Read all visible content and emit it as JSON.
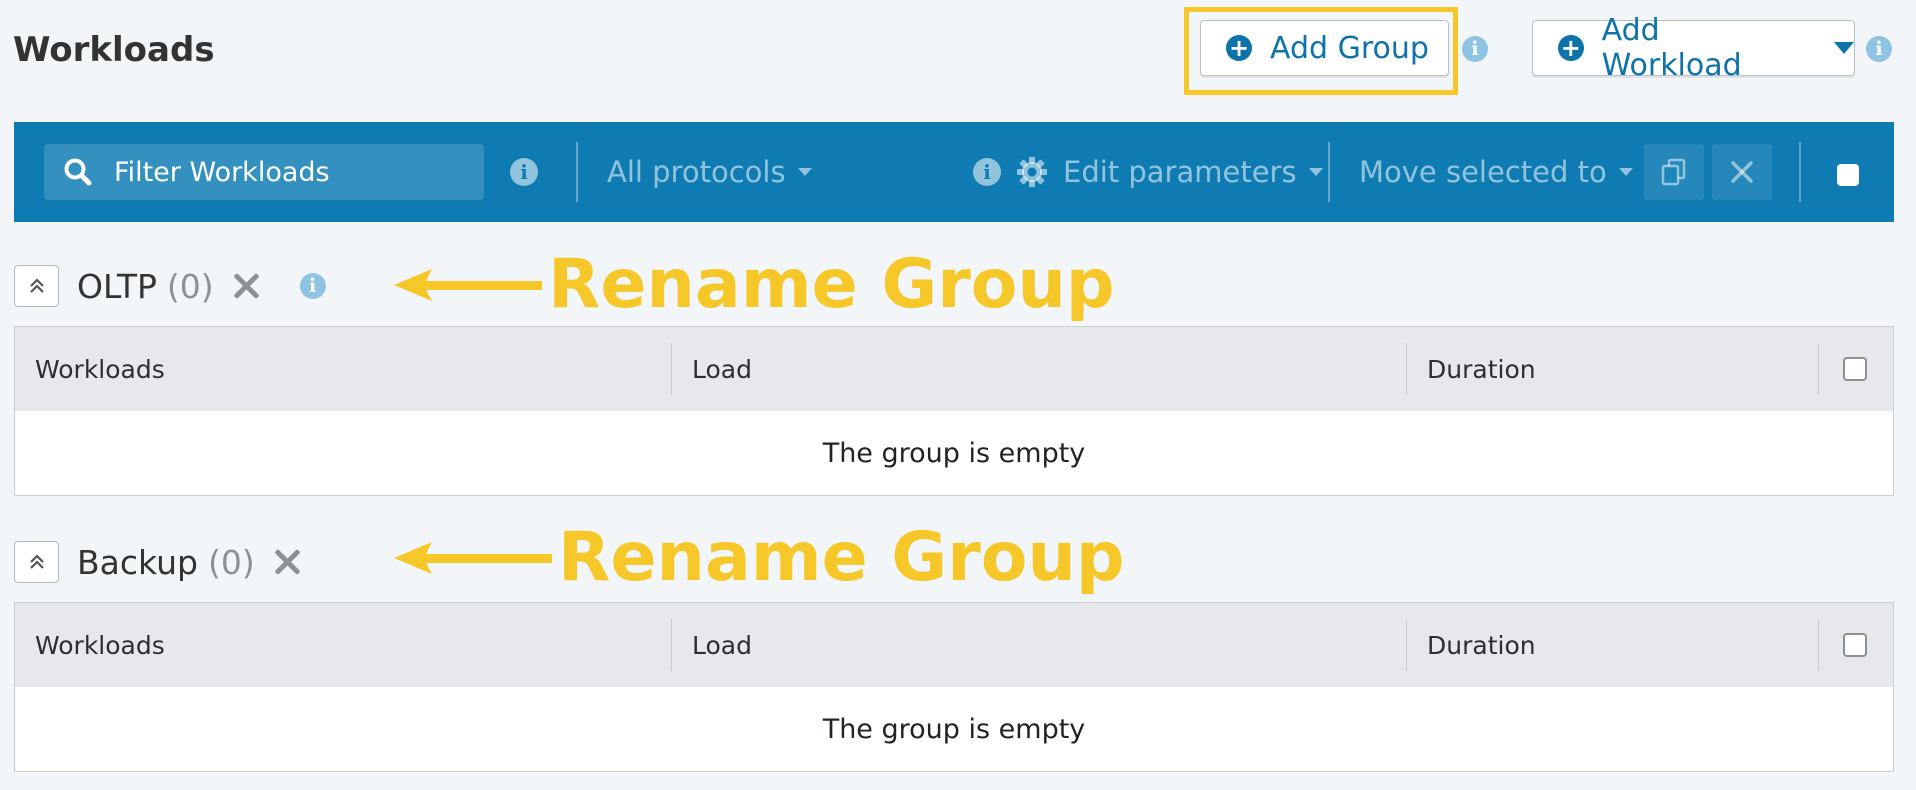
{
  "header": {
    "title": "Workloads",
    "add_group_label": "Add Group",
    "add_workload_label": "Add Workload",
    "info_glyph": "i"
  },
  "toolbar": {
    "search_placeholder": "Filter Workloads",
    "protocols_label": "All protocols",
    "edit_parameters_label": "Edit parameters",
    "move_selected_label": "Move selected to",
    "info_glyph": "i"
  },
  "annotation": {
    "text": "Rename Group",
    "color": "#f6c728"
  },
  "groups": [
    {
      "name": "OLTP",
      "count": "(0)",
      "has_info": true,
      "columns": [
        "Workloads",
        "Load",
        "Duration"
      ],
      "empty_text": "The group is empty"
    },
    {
      "name": "Backup",
      "count": "(0)",
      "has_info": false,
      "columns": [
        "Workloads",
        "Load",
        "Duration"
      ],
      "empty_text": "The group is empty"
    }
  ],
  "colors": {
    "accent": "#0d73a8",
    "toolbar_bg": "#0e7bb3",
    "highlight": "#f6c728",
    "page_bg": "#f3f6f9"
  },
  "icons": [
    "plus-circle-icon",
    "info-icon",
    "caret-down-icon",
    "search-icon",
    "gear-icon",
    "copy-icon",
    "close-icon",
    "chevron-up-double-icon"
  ]
}
